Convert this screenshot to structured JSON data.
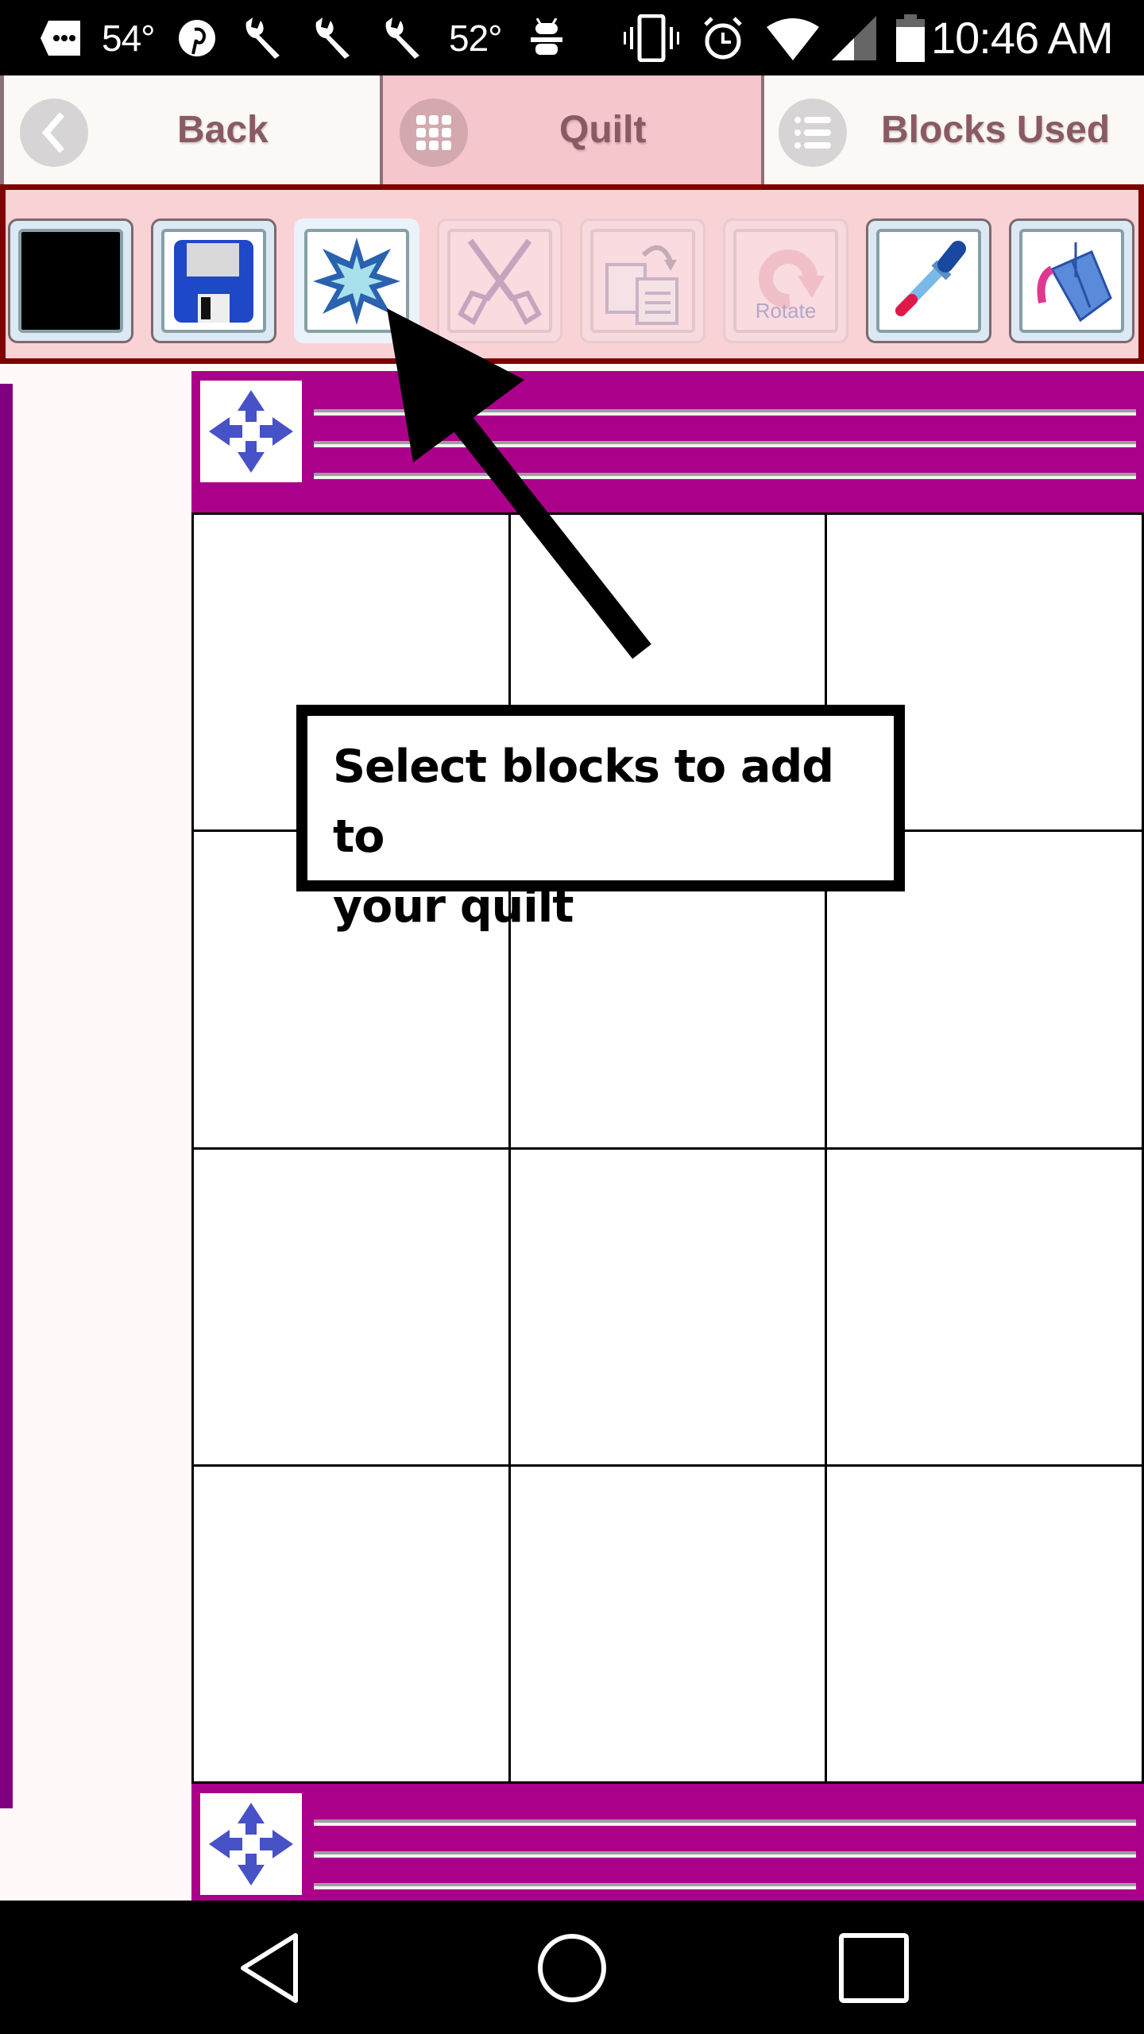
{
  "status_bar": {
    "left_icons": [
      "messages-icon",
      "pinterest-icon",
      "wrench-icon",
      "wrench-icon",
      "wrench-icon",
      "android-debug-icon"
    ],
    "temp_1": "54°",
    "temp_2": "52°",
    "right_icons": [
      "vibrate-icon",
      "alarm-icon",
      "wifi-icon",
      "cell-signal-icon",
      "battery-icon"
    ],
    "time": "10:46 AM"
  },
  "tabs": [
    {
      "label": "Back",
      "icon": "chevron-left-icon",
      "active": false
    },
    {
      "label": "Quilt",
      "icon": "grid-icon",
      "active": true
    },
    {
      "label": "Blocks Used",
      "icon": "list-icon",
      "active": false
    }
  ],
  "toolbar": {
    "tools": [
      {
        "name": "color-swatch",
        "icon": "black-swatch-icon",
        "state": "enabled"
      },
      {
        "name": "save",
        "icon": "floppy-disk-icon",
        "state": "enabled"
      },
      {
        "name": "select-blocks",
        "icon": "starburst-icon",
        "state": "active"
      },
      {
        "name": "cut",
        "icon": "scissors-icon",
        "state": "disabled"
      },
      {
        "name": "paste",
        "icon": "paste-icon",
        "state": "disabled"
      },
      {
        "name": "rotate",
        "icon": "rotate-icon",
        "state": "disabled",
        "caption": "Rotate"
      },
      {
        "name": "eyedropper",
        "icon": "eyedropper-icon",
        "state": "enabled"
      },
      {
        "name": "paint-bucket",
        "icon": "paint-bucket-icon",
        "state": "enabled"
      }
    ]
  },
  "quilt": {
    "columns": 3,
    "rows": 4,
    "band_color": "#AA008A",
    "border_color": "#800080"
  },
  "callout": {
    "line1": "Select blocks to add to",
    "line2": "your quilt"
  },
  "nav_bar": {
    "buttons": [
      "back-triangle-icon",
      "home-circle-icon",
      "recents-square-icon"
    ]
  },
  "colors": {
    "toolbar_border": "#800000",
    "toolbar_bg": "#F9D2D5",
    "active_tab_bg": "#F5C6CB",
    "tab_text": "#8A5A63"
  }
}
